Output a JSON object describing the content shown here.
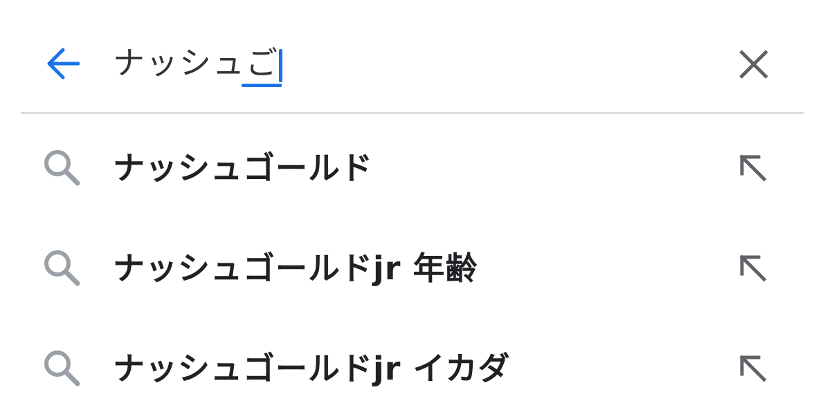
{
  "search": {
    "query_committed": "ナッシュ",
    "query_composing": "ご"
  },
  "icons": {
    "back": "arrow-left-icon",
    "clear": "close-icon",
    "suggestion": "search-icon",
    "fill": "arrow-up-left-icon"
  },
  "colors": {
    "accent": "#1a73e8",
    "text": "#202124",
    "icon_gray": "#5f6368",
    "divider": "#dadce0"
  },
  "suggestions": [
    {
      "label": "ナッシュゴールド"
    },
    {
      "label": "ナッシュゴールドjr 年齢"
    },
    {
      "label": "ナッシュゴールドjr イカダ"
    }
  ]
}
